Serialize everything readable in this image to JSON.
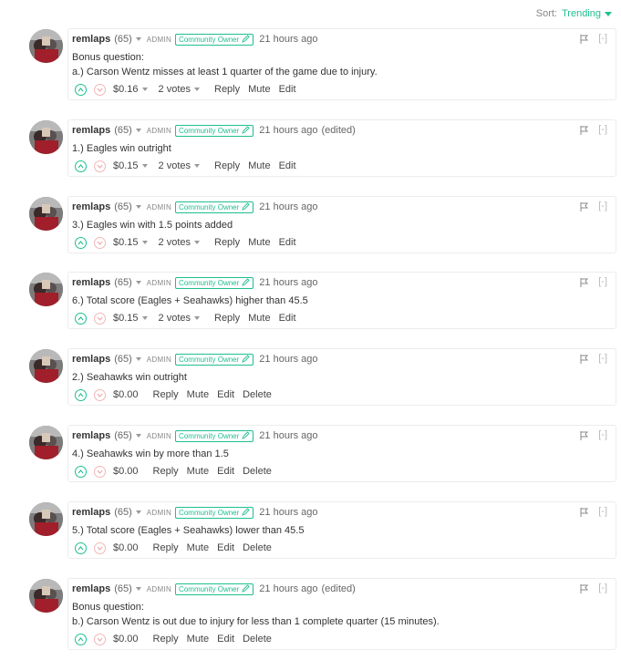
{
  "sort": {
    "label": "Sort:",
    "value": "Trending"
  },
  "comments": [
    {
      "author": "remlaps",
      "rep": "(65)",
      "role": "ADMIN",
      "badge": "Community Owner",
      "time": "21 hours ago",
      "edited": "",
      "lines": [
        "Bonus question:",
        "a.) Carson Wentz misses at least 1 quarter of the game due to injury."
      ],
      "payout": "$0.16",
      "votes": "2 votes",
      "actions": [
        "Reply",
        "Mute",
        "Edit"
      ]
    },
    {
      "author": "remlaps",
      "rep": "(65)",
      "role": "ADMIN",
      "badge": "Community Owner",
      "time": "21 hours ago",
      "edited": "(edited)",
      "lines": [
        "1.) Eagles win outright"
      ],
      "payout": "$0.15",
      "votes": "2 votes",
      "actions": [
        "Reply",
        "Mute",
        "Edit"
      ]
    },
    {
      "author": "remlaps",
      "rep": "(65)",
      "role": "ADMIN",
      "badge": "Community Owner",
      "time": "21 hours ago",
      "edited": "",
      "lines": [
        "3.) Eagles win with 1.5 points added"
      ],
      "payout": "$0.15",
      "votes": "2 votes",
      "actions": [
        "Reply",
        "Mute",
        "Edit"
      ]
    },
    {
      "author": "remlaps",
      "rep": "(65)",
      "role": "ADMIN",
      "badge": "Community Owner",
      "time": "21 hours ago",
      "edited": "",
      "lines": [
        "6.) Total score (Eagles + Seahawks) higher than 45.5"
      ],
      "payout": "$0.15",
      "votes": "2 votes",
      "actions": [
        "Reply",
        "Mute",
        "Edit"
      ]
    },
    {
      "author": "remlaps",
      "rep": "(65)",
      "role": "ADMIN",
      "badge": "Community Owner",
      "time": "21 hours ago",
      "edited": "",
      "lines": [
        "2.) Seahawks win outright"
      ],
      "payout": "$0.00",
      "votes": "",
      "actions": [
        "Reply",
        "Mute",
        "Edit",
        "Delete"
      ]
    },
    {
      "author": "remlaps",
      "rep": "(65)",
      "role": "ADMIN",
      "badge": "Community Owner",
      "time": "21 hours ago",
      "edited": "",
      "lines": [
        "4.) Seahawks win by more than 1.5"
      ],
      "payout": "$0.00",
      "votes": "",
      "actions": [
        "Reply",
        "Mute",
        "Edit",
        "Delete"
      ]
    },
    {
      "author": "remlaps",
      "rep": "(65)",
      "role": "ADMIN",
      "badge": "Community Owner",
      "time": "21 hours ago",
      "edited": "",
      "lines": [
        "5.) Total score (Eagles + Seahawks) lower than 45.5"
      ],
      "payout": "$0.00",
      "votes": "",
      "actions": [
        "Reply",
        "Mute",
        "Edit",
        "Delete"
      ]
    },
    {
      "author": "remlaps",
      "rep": "(65)",
      "role": "ADMIN",
      "badge": "Community Owner",
      "time": "21 hours ago",
      "edited": "(edited)",
      "lines": [
        "Bonus question:",
        "b.) Carson Wentz is out due to injury for less than 1 complete quarter (15 minutes)."
      ],
      "payout": "$0.00",
      "votes": "",
      "actions": [
        "Reply",
        "Mute",
        "Edit",
        "Delete"
      ]
    }
  ],
  "collapse_label": "[-]"
}
